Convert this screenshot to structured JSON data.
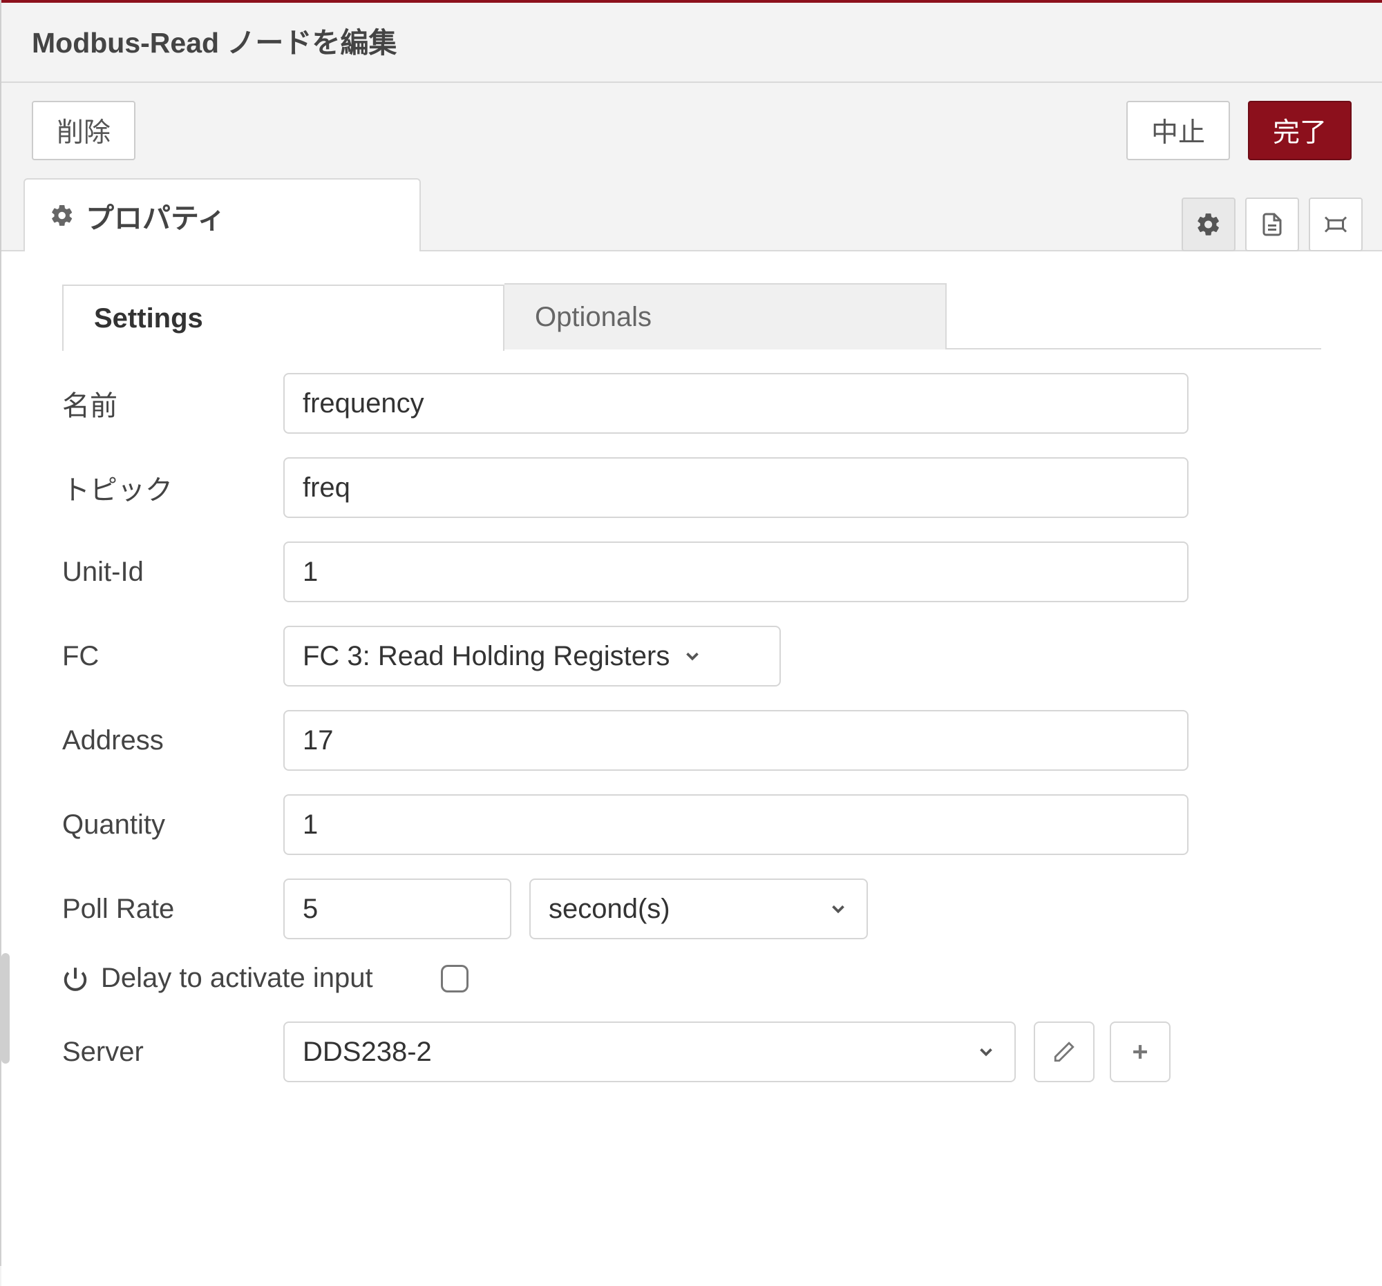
{
  "header": {
    "title": "Modbus-Read ノードを編集"
  },
  "actions": {
    "delete": "削除",
    "cancel": "中止",
    "done": "完了"
  },
  "tabs": {
    "properties": "プロパティ"
  },
  "subtabs": {
    "settings": "Settings",
    "optionals": "Optionals"
  },
  "fields": {
    "name": {
      "label": "名前",
      "value": "frequency"
    },
    "topic": {
      "label": "トピック",
      "value": "freq"
    },
    "unitId": {
      "label": "Unit-Id",
      "value": "1"
    },
    "fc": {
      "label": "FC",
      "value": "FC 3: Read Holding Registers"
    },
    "address": {
      "label": "Address",
      "value": "17"
    },
    "quantity": {
      "label": "Quantity",
      "value": "1"
    },
    "pollRate": {
      "label": "Poll Rate",
      "value": "5",
      "unit": "second(s)"
    },
    "delay": {
      "label": "Delay to activate input",
      "checked": false
    },
    "server": {
      "label": "Server",
      "value": "DDS238-2"
    }
  }
}
